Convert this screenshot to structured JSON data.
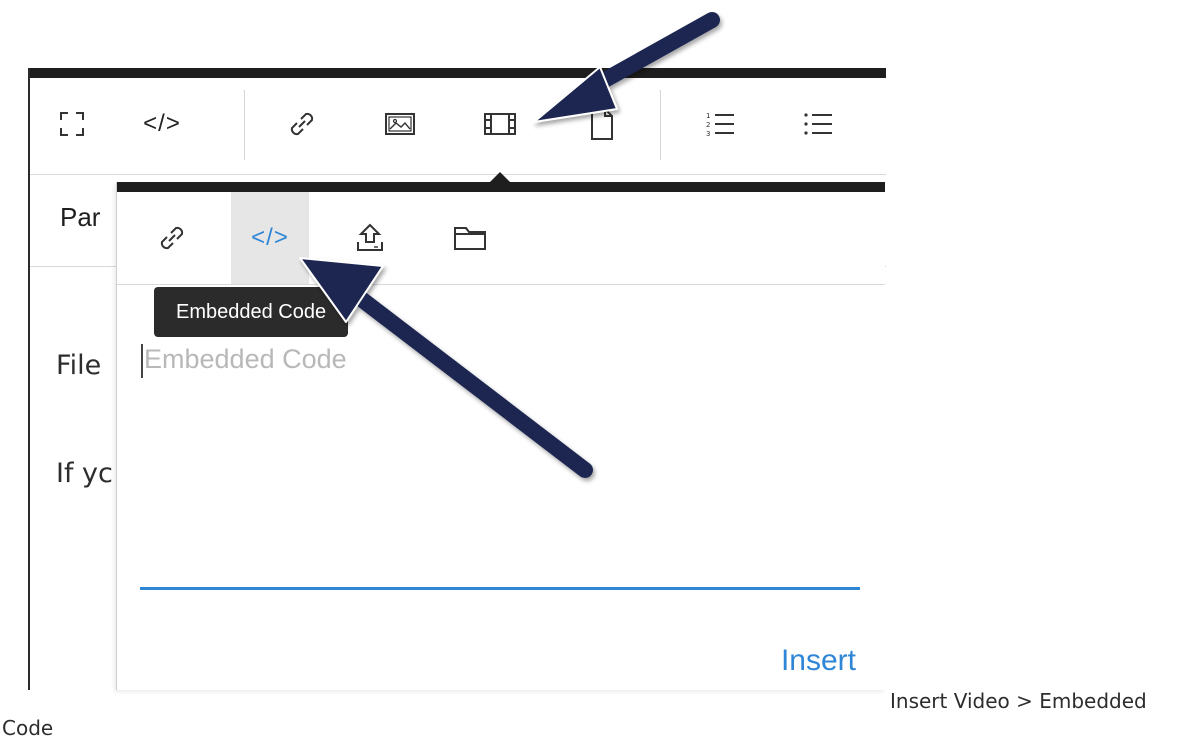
{
  "toolbar": {
    "buttons": [
      {
        "name": "fullscreen-button",
        "icon": "fullscreen-icon"
      },
      {
        "name": "html-editor-button",
        "icon": "code-icon",
        "glyph": "</>"
      },
      {
        "name": "link-button",
        "icon": "link-icon"
      },
      {
        "name": "image-button",
        "icon": "image-icon"
      },
      {
        "name": "media-button",
        "icon": "film-icon"
      },
      {
        "name": "document-button",
        "icon": "document-icon"
      },
      {
        "name": "ordered-list-button",
        "icon": "ordered-list-icon"
      },
      {
        "name": "unordered-list-button",
        "icon": "unordered-list-icon"
      }
    ]
  },
  "format": {
    "label": "Par"
  },
  "content": {
    "line1": "File",
    "line2": "If yc"
  },
  "popup": {
    "tabs": [
      {
        "name": "tab-link",
        "icon": "link-icon"
      },
      {
        "name": "tab-embedded-code",
        "icon": "code-icon",
        "glyph": "</>",
        "active": true
      },
      {
        "name": "tab-upload",
        "icon": "upload-icon"
      },
      {
        "name": "tab-folder",
        "icon": "folder-icon"
      }
    ],
    "tooltip": "Embedded Code",
    "input_placeholder": "Embedded Code",
    "insert_label": "Insert"
  },
  "caption": {
    "line1": "Insert Video > Embedded",
    "line2": "Code"
  },
  "colors": {
    "accent": "#2f86d6",
    "arrow": "#1b2651",
    "dark_bar": "#1e1e1e"
  }
}
